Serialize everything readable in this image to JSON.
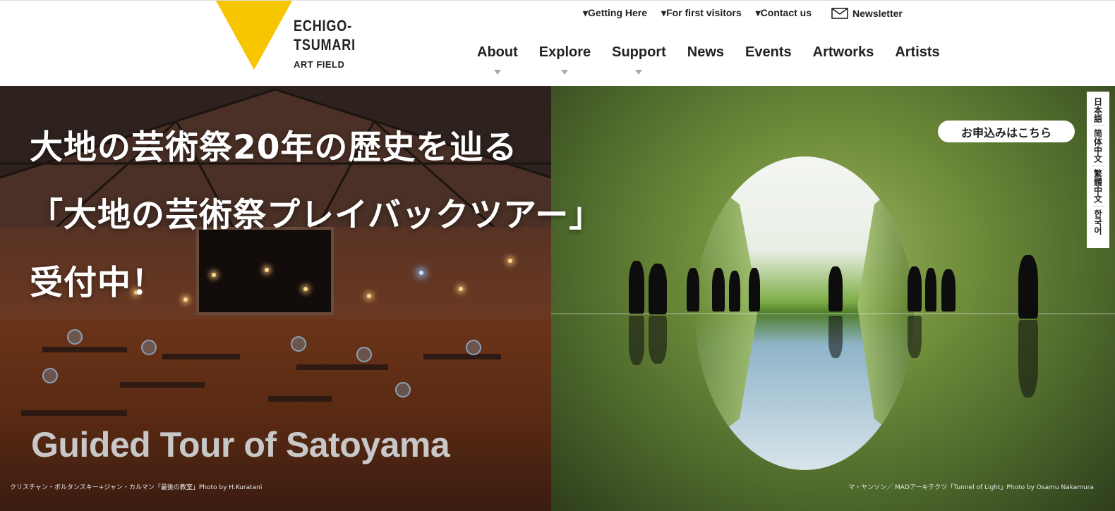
{
  "brand": {
    "line1": "ECHIGO-",
    "line2": "TSUMARI",
    "line3": "ART FIELD",
    "accent": "#f7c600"
  },
  "utility_nav": [
    {
      "label": "▾Getting Here",
      "icon": "triangle-down-icon"
    },
    {
      "label": "▾For first visitors",
      "icon": "triangle-down-icon"
    },
    {
      "label": "▾Contact us",
      "icon": "triangle-down-icon"
    },
    {
      "label": "Newsletter",
      "icon": "mail-icon"
    }
  ],
  "main_nav": [
    {
      "label": "About",
      "has_dropdown": true
    },
    {
      "label": "Explore",
      "has_dropdown": true
    },
    {
      "label": "Support",
      "has_dropdown": true
    },
    {
      "label": "News",
      "has_dropdown": false
    },
    {
      "label": "Events",
      "has_dropdown": false
    },
    {
      "label": "Artworks",
      "has_dropdown": false
    },
    {
      "label": "Artists",
      "has_dropdown": false
    }
  ],
  "hero": {
    "heading_line1": "大地の芸術祭20年の歴史を辿る",
    "heading_line2": "「大地の芸術祭プレイバックツアー」",
    "heading_line3": "受付中！",
    "english_title": "Guided Tour of Satoyama",
    "apply_button": "お申込みはこちら",
    "caption_left": "クリスチャン・ボルタンスキー+ジャン・カルマン「最後の教室」Photo by H.Kuratani",
    "caption_right": "マ・ヤンソン／ MADアーキテクツ「Tunnel of Light」Photo by Osamu Nakamura"
  },
  "languages": [
    {
      "label": "日本語"
    },
    {
      "label": "简体中文"
    },
    {
      "label": "繁體中文"
    },
    {
      "label": "한국어"
    }
  ]
}
